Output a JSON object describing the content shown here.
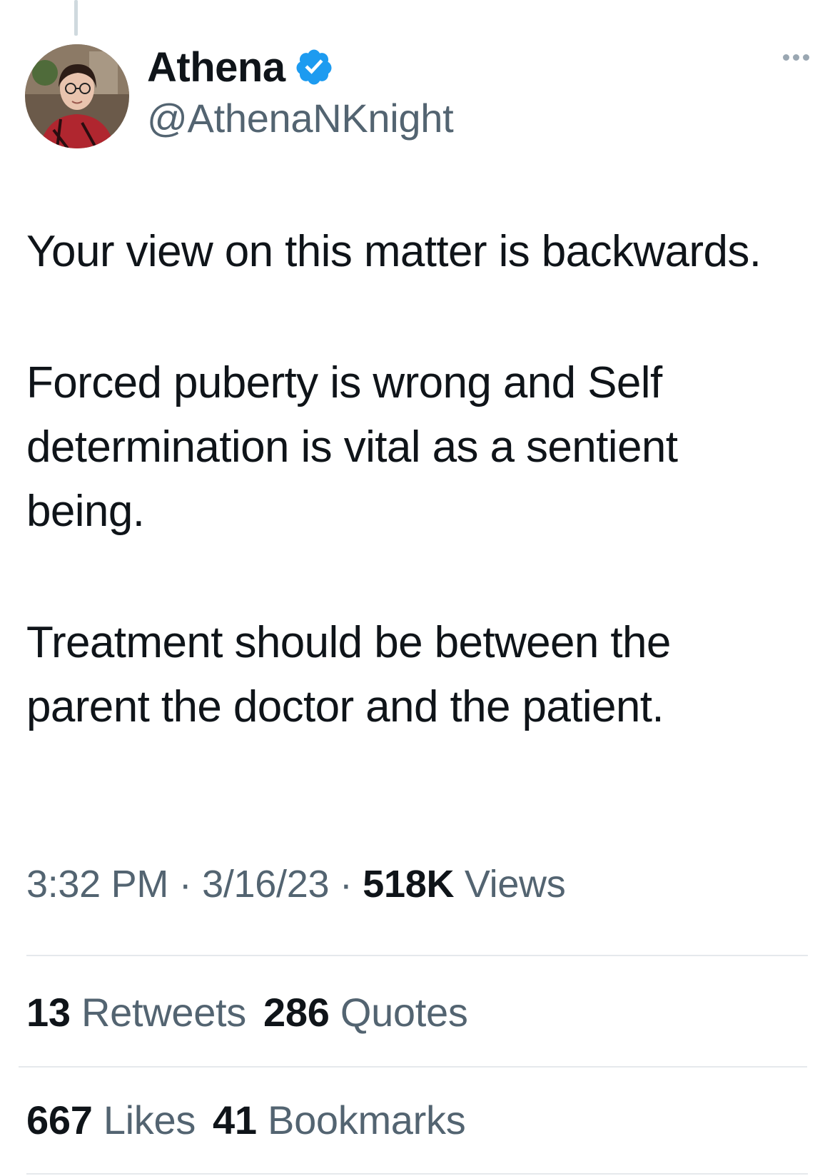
{
  "tweet": {
    "author": {
      "display_name": "Athena",
      "handle": "@AthenaNKnight",
      "verified": true,
      "verified_badge_color": "#1d9bf0",
      "avatar_icon": "profile-photo"
    },
    "more_icon": "more-horizontal-icon",
    "text_paragraphs": [
      "Your view on this matter is backwards.",
      "Forced puberty is wrong and Self determination is vital as a sentient being.",
      "Treatment should be between the parent the doctor and the patient."
    ],
    "meta": {
      "time": "3:32 PM",
      "separator": "·",
      "date": "3/16/23",
      "views_count": "518K",
      "views_label": "Views"
    },
    "stats": {
      "retweets_count": "13",
      "retweets_label": "Retweets",
      "quotes_count": "286",
      "quotes_label": "Quotes",
      "likes_count": "667",
      "likes_label": "Likes",
      "bookmarks_count": "41",
      "bookmarks_label": "Bookmarks"
    }
  }
}
